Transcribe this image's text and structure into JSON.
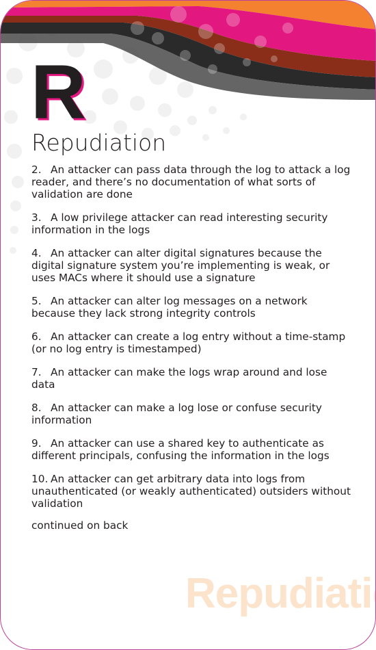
{
  "card": {
    "letter": "R",
    "title": "Repudiation",
    "watermark": "Repudiation",
    "continued": "continued on back",
    "colors": {
      "orange": "#f4812f",
      "magenta": "#e2177f",
      "brown": "#8a2e1a",
      "dark": "#2a2a2a",
      "grey": "#4a4a4a",
      "border": "#b9419b",
      "watermark": "#fbe3cc"
    },
    "items": [
      {
        "num": "2.",
        "text": "An attacker can pass data through the log to attack a log reader, and there’s no documentation of what sorts of validation are done"
      },
      {
        "num": "3.",
        "text": "A low privilege attacker can read interesting security information in the logs"
      },
      {
        "num": "4.",
        "text": "An attacker can alter digital signatures because the digital signature system you’re implementing is weak, or uses MACs where it should use a signature"
      },
      {
        "num": "5.",
        "text": "An attacker can alter log messages on a network because they lack strong integrity controls"
      },
      {
        "num": "6.",
        "text": "An attacker can create a log entry without a time-stamp (or no log entry is timestamped)"
      },
      {
        "num": "7.",
        "text": "An attacker can make the logs wrap around and lose data"
      },
      {
        "num": "8.",
        "text": "An attacker can make a log lose or confuse security information"
      },
      {
        "num": "9.",
        "text": "An attacker can use a shared key to authenticate as different principals, confusing the information in the logs"
      },
      {
        "num": "10.",
        "text": "An attacker can get arbitrary data into logs from unauthenticated (or weakly authenticated) outsiders without validation"
      }
    ]
  }
}
